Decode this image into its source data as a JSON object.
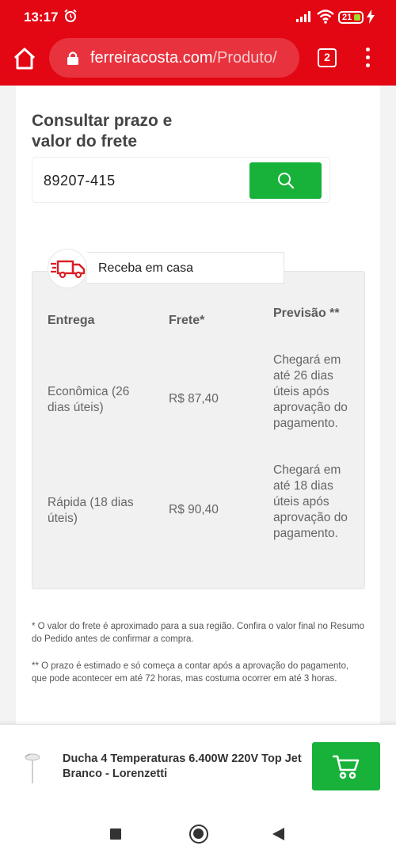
{
  "status_bar": {
    "time": "13:17",
    "battery": "21"
  },
  "browser": {
    "url_domain": "ferreiracosta.com",
    "url_path": "/Produto/",
    "tab_count": "2"
  },
  "shipping": {
    "title": "Consultar prazo e valor do frete",
    "cep_value": "89207-415",
    "delivery_tab_label": "Receba em casa",
    "headers": {
      "entrega": "Entrega",
      "frete": "Frete*",
      "previsao": "Previsão **"
    },
    "rows": [
      {
        "entrega": "Econômica (26 dias úteis)",
        "frete": "R$ 87,40",
        "previsao": "Chegará em até 26 dias úteis após aprovação do pagamento."
      },
      {
        "entrega": "Rápida (18 dias úteis)",
        "frete": "R$ 90,40",
        "previsao": "Chegará em até 18 dias úteis após aprovação do pagamento."
      }
    ],
    "note1": "* O valor do frete é aproximado para a sua região. Confira o valor final no Resumo do Pedido antes de confirmar a compra.",
    "note2": "** O prazo é estimado e só começa a contar após a aprovação do pagamento, que pode acontecer em até 72 horas, mas costuma ocorrer em até 3 horas."
  },
  "product_bar": {
    "name": "Ducha 4 Temperaturas 6.400W 220V Top Jet Branco - Lorenzetti"
  },
  "colors": {
    "brand_red": "#e30613",
    "action_green": "#18b23a"
  }
}
